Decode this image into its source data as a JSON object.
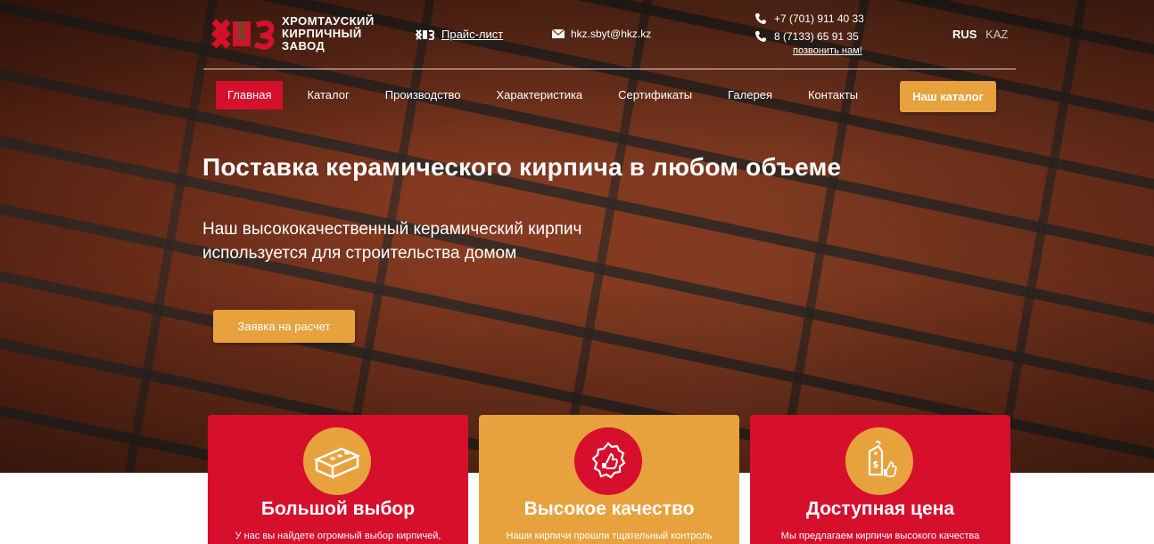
{
  "header": {
    "logo_text": "ХРОМТАУСКИЙ КИРПИЧНЫЙ ЗАВОД",
    "price_list": "Прайс-лист",
    "email": "hkz.sbyt@hkz.kz",
    "phones": [
      "+7 (701) 911 40 33",
      "8 (7133) 65 91 35"
    ],
    "call_me": "позвонить нам!",
    "lang": {
      "active": "RUS",
      "other": "KAZ"
    }
  },
  "nav": {
    "items": [
      "Главная",
      "Каталог",
      "Производство",
      "Характеристика",
      "Сертификаты",
      "Галерея",
      "Контакты"
    ],
    "active_index": 0,
    "catalog_button": "Наш каталог"
  },
  "hero": {
    "title": "Поставка керамического кирпича в любом объеме",
    "subtitle": "Наш высококачественный керамический кирпич используется для строительства домом",
    "order_button": "Заявка на расчет"
  },
  "features": [
    {
      "title": "Большой выбор",
      "desc": "У нас вы найдете огромный выбор кирпичей,",
      "icon": "brick-icon"
    },
    {
      "title": "Высокое качество",
      "desc": "Наши кирпичи прошли тщательный контроль",
      "icon": "quality-badge-icon"
    },
    {
      "title": "Доступная цена",
      "desc": "Мы предлагаем кирпичи высокого качества",
      "icon": "price-tag-icon"
    }
  ],
  "colors": {
    "brand_red": "#d6102c",
    "accent_orange": "#e8a23d"
  }
}
